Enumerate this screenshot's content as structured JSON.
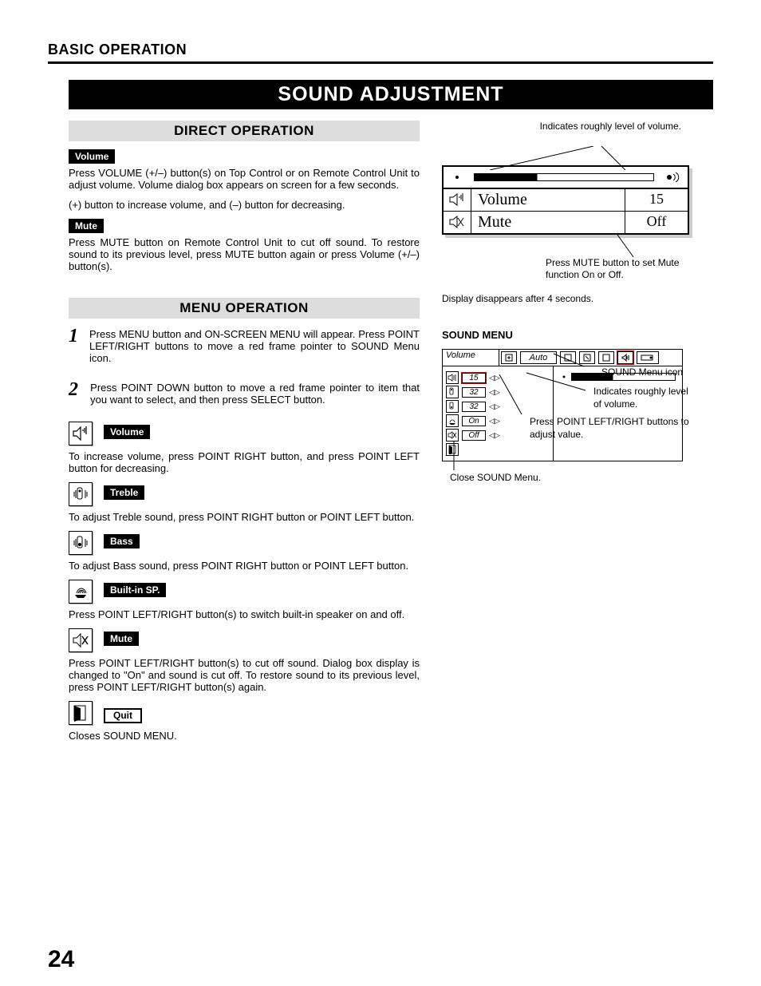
{
  "chapter": "BASIC OPERATION",
  "title": "SOUND ADJUSTMENT",
  "direct": {
    "heading": "DIRECT OPERATION",
    "volume_tag": "Volume",
    "volume_p1": "Press VOLUME (+/–) button(s) on Top Control or on Remote Control Unit to adjust volume.  Volume dialog box appears on screen for a few seconds.",
    "volume_p2": "(+) button to increase volume, and (–) button for decreasing.",
    "mute_tag": "Mute",
    "mute_p": "Press MUTE button on Remote Control Unit to cut off sound.  To restore sound to its previous level, press MUTE button again or press Volume (+/–) button(s)."
  },
  "menu": {
    "heading": "MENU OPERATION",
    "step1": "Press MENU button and ON-SCREEN MENU will appear.  Press POINT LEFT/RIGHT buttons to move a red frame pointer to SOUND Menu icon.",
    "step2": "Press POINT DOWN button to move a red frame pointer to item that you want to select, and then press SELECT button.",
    "volume_tag": "Volume",
    "volume_p": "To increase volume, press POINT RIGHT button, and press POINT LEFT button for decreasing.",
    "treble_tag": "Treble",
    "treble_p": "To adjust Treble sound, press POINT RIGHT button or POINT LEFT button.",
    "bass_tag": "Bass",
    "bass_p": "To adjust Bass sound, press POINT RIGHT button or POINT LEFT button.",
    "builtin_tag": "Built-in SP.",
    "builtin_p": "Press POINT LEFT/RIGHT button(s) to switch built-in speaker on and off.",
    "mute_tag": "Mute",
    "mute_p": "Press POINT LEFT/RIGHT button(s) to cut off sound.  Dialog box display is changed to \"On\" and sound is cut off.  To restore sound to its previous level, press POINT LEFT/RIGHT button(s) again.",
    "quit_tag": "Quit",
    "quit_p": "Closes SOUND MENU."
  },
  "fig1": {
    "callout_top": "Indicates roughly level of volume.",
    "volume_label": "Volume",
    "volume_value": "15",
    "mute_label": "Mute",
    "mute_value": "Off",
    "callout_mute": "Press MUTE button to set Mute function On or Off.",
    "disappear": "Display disappears after 4 seconds."
  },
  "fig2": {
    "heading": "SOUND MENU",
    "top_label": "Volume",
    "auto": "Auto",
    "rows": {
      "r0": "15",
      "r1": "32",
      "r2": "32",
      "r3": "On",
      "r4": "Off"
    },
    "ann_icon": "SOUND Menu icon",
    "ann_level": "Indicates roughly level of volume.",
    "ann_adjust": "Press POINT LEFT/RIGHT buttons to adjust value.",
    "ann_close": "Close SOUND Menu."
  },
  "page": "24"
}
